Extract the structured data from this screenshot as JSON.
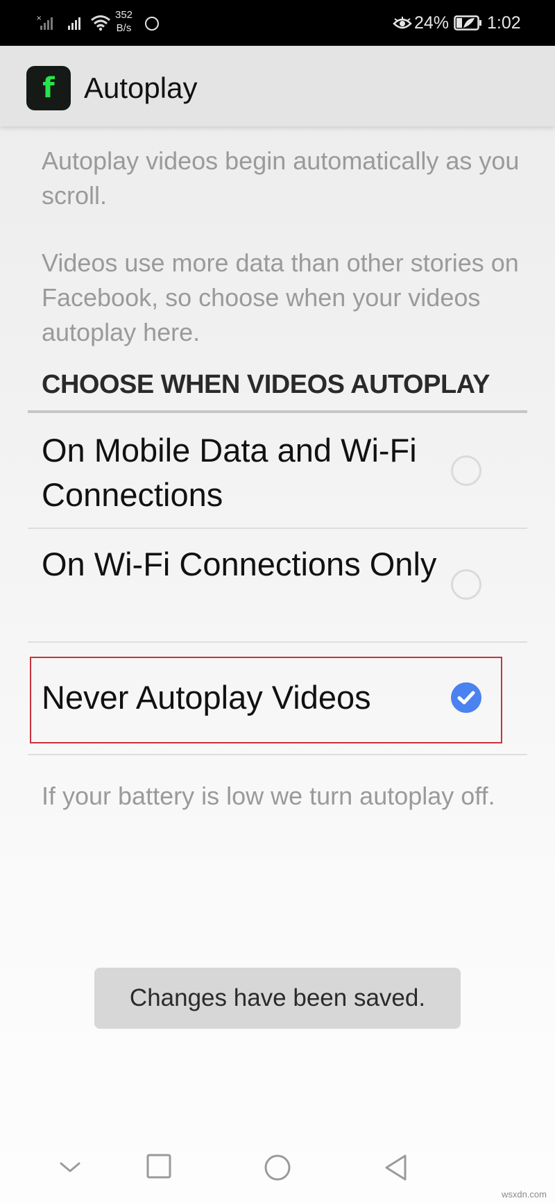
{
  "status_bar": {
    "net_speed_value": "352",
    "net_speed_unit": "B/s",
    "battery_percent": "24%",
    "time": "1:02"
  },
  "app_bar": {
    "logo_letter": "f",
    "title": "Autoplay"
  },
  "content": {
    "intro_text": "Autoplay videos begin automatically as you scroll.",
    "data_text": "Videos use more data than other stories on Facebook, so choose when your videos autoplay here.",
    "section_header": "CHOOSE WHEN VIDEOS AUTOPLAY",
    "options": [
      {
        "label": "On Mobile Data and Wi-Fi Connections",
        "selected": false
      },
      {
        "label": "On Wi-Fi Connections Only",
        "selected": false
      },
      {
        "label": "Never Autoplay Videos",
        "selected": true
      }
    ],
    "battery_note": "If your battery is low we turn autoplay off."
  },
  "toast": {
    "message": "Changes have been saved."
  },
  "watermark": "wsxdn.com",
  "colors": {
    "status_bar_bg": "#000000",
    "app_bar_bg": "#e4e4e4",
    "logo_bg": "#161a17",
    "logo_fg": "#28e44c",
    "accent_check": "#4a82f0",
    "highlight_box": "#c8323c",
    "toast_bg": "#d7d7d7"
  },
  "icons": {
    "status": [
      "signal-no-sim-icon",
      "signal-icon",
      "wifi-icon",
      "circle-icon",
      "eye-icon",
      "battery-icon"
    ],
    "navigation": [
      "down-chevron-icon",
      "recents-square-icon",
      "home-circle-icon",
      "back-triangle-icon"
    ]
  }
}
